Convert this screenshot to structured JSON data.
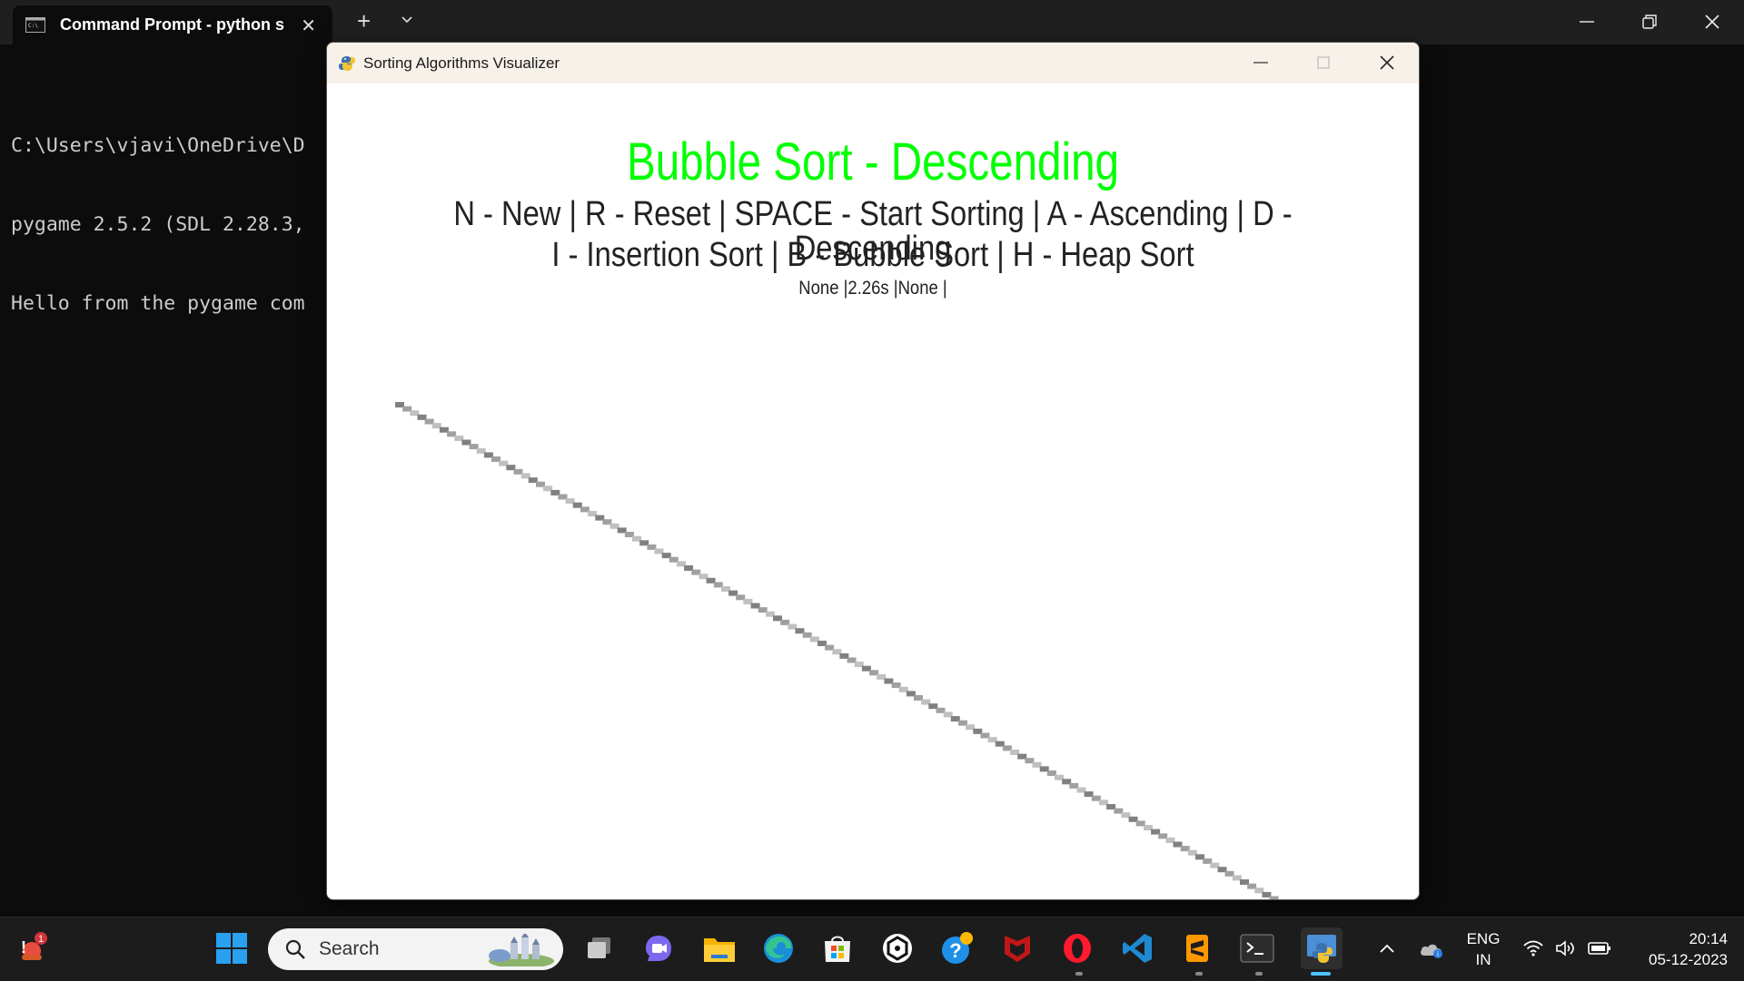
{
  "terminal": {
    "tab_title": "Command Prompt - python s",
    "lines": [
      "C:\\Users\\vjavi\\OneDrive\\D",
      "pygame 2.5.2 (SDL 2.28.3,",
      "Hello from the pygame com"
    ]
  },
  "pygame_window": {
    "title": "Sorting Algorithms Visualizer",
    "heading": "Bubble Sort - Descending",
    "heading_color": "#00ff00",
    "controls_line1": "N - New | R - Reset | SPACE - Start Sorting | A - Ascending | D - Descending",
    "controls_line2": "I - Insertion Sort | B - Bubble Sort | H - Heap Sort",
    "status": "None |2.26s |None |",
    "bar_colors": [
      "#808080",
      "#a0a0a0",
      "#c0c0c0"
    ]
  },
  "taskbar": {
    "search_placeholder": "Search",
    "language_line1": "ENG",
    "language_line2": "IN",
    "time": "20:14",
    "date": "05-12-2023",
    "notification_badge": "1"
  }
}
